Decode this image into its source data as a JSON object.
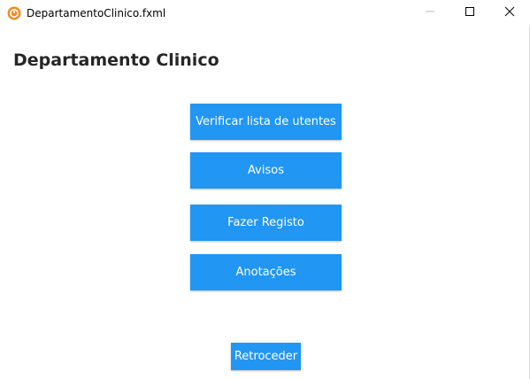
{
  "window": {
    "title": "DepartamentoClinico.fxml",
    "icon": "java-app-icon",
    "controls": [
      "minimize-icon",
      "maximize-icon",
      "close-icon"
    ]
  },
  "page": {
    "heading": "Departamento Clinico"
  },
  "menu": {
    "buttons": [
      {
        "label": "Verificar lista de utentes"
      },
      {
        "label": "Avisos"
      },
      {
        "label": "Fazer Registo"
      },
      {
        "label": "Anotações"
      }
    ],
    "back_label": "Retroceder"
  },
  "colors": {
    "accent": "#2196f3",
    "heading": "#262626",
    "background": "#ffffff"
  }
}
